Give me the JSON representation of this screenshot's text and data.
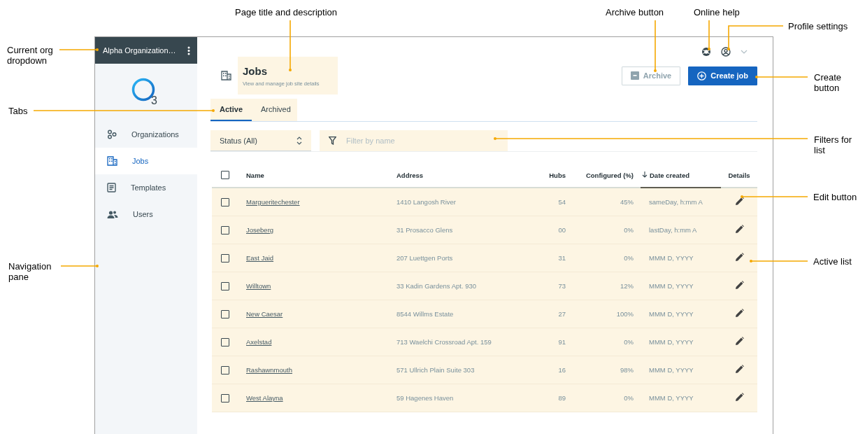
{
  "org_dropdown": {
    "label": "Alpha Organization…"
  },
  "logo": {
    "subscript": "3"
  },
  "nav": [
    {
      "label": "Organizations",
      "selected": false
    },
    {
      "label": "Jobs",
      "selected": true
    },
    {
      "label": "Templates",
      "selected": false
    },
    {
      "label": "Users",
      "selected": false
    }
  ],
  "page": {
    "title": "Jobs",
    "description": "View and manage job site details"
  },
  "buttons": [
    {
      "label": "Archive",
      "kind": "secondary",
      "disabled": true
    },
    {
      "label": "Create job",
      "kind": "primary",
      "disabled": false
    }
  ],
  "tabs": [
    {
      "label": "Active",
      "selected": true
    },
    {
      "label": "Archived",
      "selected": false
    }
  ],
  "filters": {
    "status": {
      "value": "Status (All)"
    },
    "name": {
      "placeholder": "Filter by name"
    }
  },
  "table": {
    "select_all": {
      "checked": false
    },
    "columns": [
      {
        "label": "Name",
        "sorted": false
      },
      {
        "label": "Address",
        "sorted": false
      },
      {
        "label": "Hubs",
        "sorted": false
      },
      {
        "label": "Configured (%)",
        "sorted": false
      },
      {
        "label": "Date created",
        "sorted": true
      },
      {
        "label": "Details",
        "sorted": false
      }
    ],
    "rows": [
      {
        "checked": false,
        "name": "Margueritechester",
        "address": "1410 Langosh River",
        "hubs": "54",
        "configured": "45%",
        "date": "sameDay, h:mm A"
      },
      {
        "checked": false,
        "name": "Joseberg",
        "address": "31 Prosacco Glens",
        "hubs": "00",
        "configured": "0%",
        "date": "lastDay, h:mm A"
      },
      {
        "checked": false,
        "name": "East Jaid",
        "address": "207 Luettgen Ports",
        "hubs": "31",
        "configured": "0%",
        "date": "MMM D, YYYY"
      },
      {
        "checked": false,
        "name": "Willtown",
        "address": "33 Kadin Gardens Apt. 930",
        "hubs": "73",
        "configured": "12%",
        "date": "MMM D, YYYY"
      },
      {
        "checked": false,
        "name": "New Caesar",
        "address": "8544 Willms Estate",
        "hubs": "27",
        "configured": "100%",
        "date": "MMM D, YYYY"
      },
      {
        "checked": false,
        "name": "Axelstad",
        "address": "713 Waelchi Crossroad Apt. 159",
        "hubs": "91",
        "configured": "0%",
        "date": "MMM D, YYYY"
      },
      {
        "checked": false,
        "name": "Rashawnmouth",
        "address": "571 Ullrich Plain Suite 303",
        "hubs": "16",
        "configured": "98%",
        "date": "MMM D, YYYY"
      },
      {
        "checked": false,
        "name": "West Alayna",
        "address": "59 Hagenes Haven",
        "hubs": "89",
        "configured": "0%",
        "date": "MMM D, YYYY"
      }
    ]
  },
  "annotations": [
    {
      "text": "Page title and description"
    },
    {
      "text": "Archive button"
    },
    {
      "text": "Online help"
    },
    {
      "text": "Profile settings"
    },
    {
      "text": "Create button"
    },
    {
      "text": "Current org dropdown"
    },
    {
      "text": "Tabs"
    },
    {
      "text": "Filters for list"
    },
    {
      "text": "Edit button"
    },
    {
      "text": "Navigation pane"
    },
    {
      "text": "Active list"
    }
  ]
}
